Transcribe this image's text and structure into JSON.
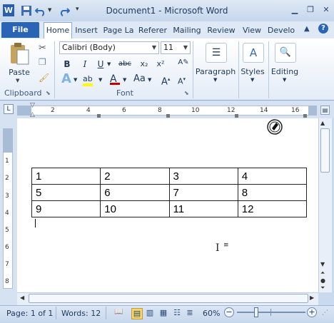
{
  "window": {
    "title": "Document1 - Microsoft Word",
    "app_icon": "W",
    "controls": [
      "minimize-icon",
      "restore-icon",
      "close-icon"
    ]
  },
  "tabs": [
    {
      "label": "File"
    },
    {
      "label": "Home"
    },
    {
      "label": "Insert"
    },
    {
      "label": "Page La"
    },
    {
      "label": "Referer"
    },
    {
      "label": "Mailing"
    },
    {
      "label": "Review"
    },
    {
      "label": "View"
    },
    {
      "label": "Develo"
    }
  ],
  "ribbon": {
    "clipboard": {
      "paste": "Paste",
      "label": "Clipboard"
    },
    "font": {
      "name": "Calibri (Body)",
      "size": "11",
      "label": "Font"
    },
    "paragraph": "Paragraph",
    "styles": "Styles",
    "editing": "Editing"
  },
  "ruler": {
    "numbers": [
      "2",
      "4",
      "6",
      "8",
      "10",
      "12",
      "14",
      "16"
    ],
    "vnumbers": [
      "1",
      "2",
      "3",
      "4",
      "5",
      "6",
      "7",
      "8"
    ]
  },
  "table": [
    [
      "1",
      "2",
      "3",
      "4"
    ],
    [
      "5",
      "6",
      "7",
      "8"
    ],
    [
      "9",
      "10",
      "11",
      "12"
    ]
  ],
  "status": {
    "page": "Page: 1 of 1",
    "words": "Words: 12",
    "zoom": "60%",
    "zoom_level": 60
  },
  "colors": {
    "file_tab": "#2a64b7",
    "ribbon_border": "#8ba9cf",
    "highlight": "#ffff00",
    "font_color": "#c00000"
  }
}
